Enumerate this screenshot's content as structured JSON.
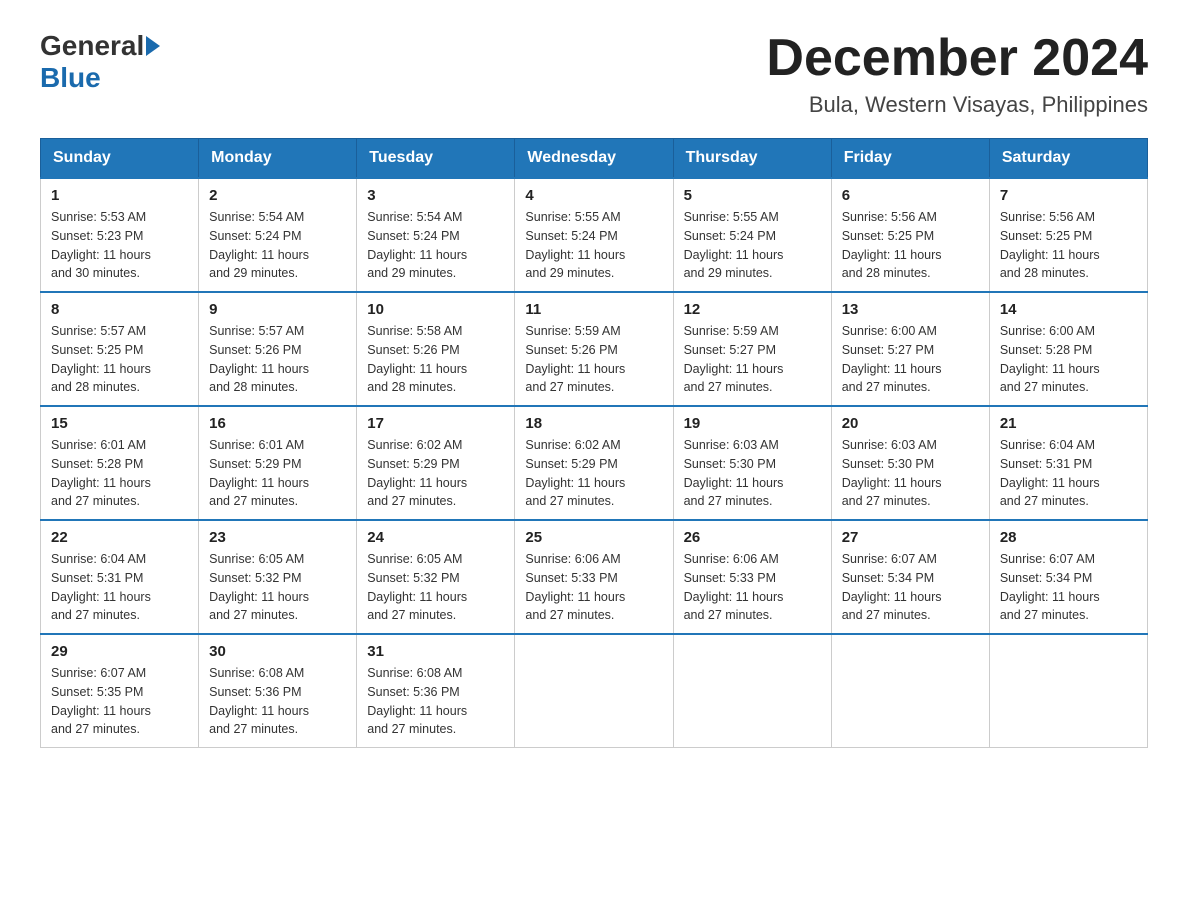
{
  "header": {
    "logo_general": "General",
    "logo_blue": "Blue",
    "month_title": "December 2024",
    "location": "Bula, Western Visayas, Philippines"
  },
  "days": [
    "Sunday",
    "Monday",
    "Tuesday",
    "Wednesday",
    "Thursday",
    "Friday",
    "Saturday"
  ],
  "weeks": [
    [
      {
        "date": "1",
        "sunrise": "5:53 AM",
        "sunset": "5:23 PM",
        "daylight": "11 hours and 30 minutes."
      },
      {
        "date": "2",
        "sunrise": "5:54 AM",
        "sunset": "5:24 PM",
        "daylight": "11 hours and 29 minutes."
      },
      {
        "date": "3",
        "sunrise": "5:54 AM",
        "sunset": "5:24 PM",
        "daylight": "11 hours and 29 minutes."
      },
      {
        "date": "4",
        "sunrise": "5:55 AM",
        "sunset": "5:24 PM",
        "daylight": "11 hours and 29 minutes."
      },
      {
        "date": "5",
        "sunrise": "5:55 AM",
        "sunset": "5:24 PM",
        "daylight": "11 hours and 29 minutes."
      },
      {
        "date": "6",
        "sunrise": "5:56 AM",
        "sunset": "5:25 PM",
        "daylight": "11 hours and 28 minutes."
      },
      {
        "date": "7",
        "sunrise": "5:56 AM",
        "sunset": "5:25 PM",
        "daylight": "11 hours and 28 minutes."
      }
    ],
    [
      {
        "date": "8",
        "sunrise": "5:57 AM",
        "sunset": "5:25 PM",
        "daylight": "11 hours and 28 minutes."
      },
      {
        "date": "9",
        "sunrise": "5:57 AM",
        "sunset": "5:26 PM",
        "daylight": "11 hours and 28 minutes."
      },
      {
        "date": "10",
        "sunrise": "5:58 AM",
        "sunset": "5:26 PM",
        "daylight": "11 hours and 28 minutes."
      },
      {
        "date": "11",
        "sunrise": "5:59 AM",
        "sunset": "5:26 PM",
        "daylight": "11 hours and 27 minutes."
      },
      {
        "date": "12",
        "sunrise": "5:59 AM",
        "sunset": "5:27 PM",
        "daylight": "11 hours and 27 minutes."
      },
      {
        "date": "13",
        "sunrise": "6:00 AM",
        "sunset": "5:27 PM",
        "daylight": "11 hours and 27 minutes."
      },
      {
        "date": "14",
        "sunrise": "6:00 AM",
        "sunset": "5:28 PM",
        "daylight": "11 hours and 27 minutes."
      }
    ],
    [
      {
        "date": "15",
        "sunrise": "6:01 AM",
        "sunset": "5:28 PM",
        "daylight": "11 hours and 27 minutes."
      },
      {
        "date": "16",
        "sunrise": "6:01 AM",
        "sunset": "5:29 PM",
        "daylight": "11 hours and 27 minutes."
      },
      {
        "date": "17",
        "sunrise": "6:02 AM",
        "sunset": "5:29 PM",
        "daylight": "11 hours and 27 minutes."
      },
      {
        "date": "18",
        "sunrise": "6:02 AM",
        "sunset": "5:29 PM",
        "daylight": "11 hours and 27 minutes."
      },
      {
        "date": "19",
        "sunrise": "6:03 AM",
        "sunset": "5:30 PM",
        "daylight": "11 hours and 27 minutes."
      },
      {
        "date": "20",
        "sunrise": "6:03 AM",
        "sunset": "5:30 PM",
        "daylight": "11 hours and 27 minutes."
      },
      {
        "date": "21",
        "sunrise": "6:04 AM",
        "sunset": "5:31 PM",
        "daylight": "11 hours and 27 minutes."
      }
    ],
    [
      {
        "date": "22",
        "sunrise": "6:04 AM",
        "sunset": "5:31 PM",
        "daylight": "11 hours and 27 minutes."
      },
      {
        "date": "23",
        "sunrise": "6:05 AM",
        "sunset": "5:32 PM",
        "daylight": "11 hours and 27 minutes."
      },
      {
        "date": "24",
        "sunrise": "6:05 AM",
        "sunset": "5:32 PM",
        "daylight": "11 hours and 27 minutes."
      },
      {
        "date": "25",
        "sunrise": "6:06 AM",
        "sunset": "5:33 PM",
        "daylight": "11 hours and 27 minutes."
      },
      {
        "date": "26",
        "sunrise": "6:06 AM",
        "sunset": "5:33 PM",
        "daylight": "11 hours and 27 minutes."
      },
      {
        "date": "27",
        "sunrise": "6:07 AM",
        "sunset": "5:34 PM",
        "daylight": "11 hours and 27 minutes."
      },
      {
        "date": "28",
        "sunrise": "6:07 AM",
        "sunset": "5:34 PM",
        "daylight": "11 hours and 27 minutes."
      }
    ],
    [
      {
        "date": "29",
        "sunrise": "6:07 AM",
        "sunset": "5:35 PM",
        "daylight": "11 hours and 27 minutes."
      },
      {
        "date": "30",
        "sunrise": "6:08 AM",
        "sunset": "5:36 PM",
        "daylight": "11 hours and 27 minutes."
      },
      {
        "date": "31",
        "sunrise": "6:08 AM",
        "sunset": "5:36 PM",
        "daylight": "11 hours and 27 minutes."
      },
      null,
      null,
      null,
      null
    ]
  ],
  "labels": {
    "sunrise": "Sunrise:",
    "sunset": "Sunset:",
    "daylight": "Daylight:"
  }
}
